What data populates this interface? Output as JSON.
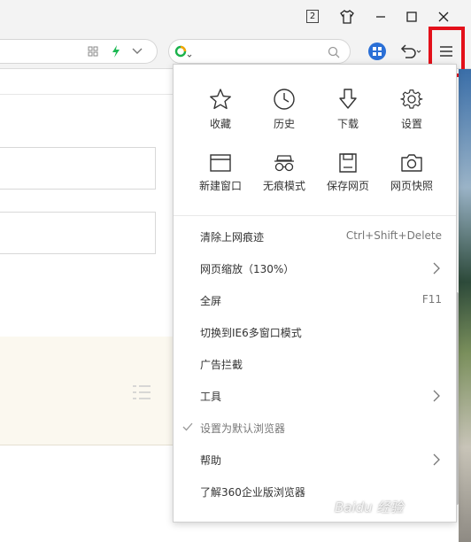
{
  "titlebar": {
    "tab_count": "2",
    "icons": [
      "skin-icon",
      "minimize-icon",
      "maximize-icon",
      "close-icon"
    ]
  },
  "toolbar": {
    "icons": [
      "grid-icon",
      "lightning-icon",
      "chevron-down-icon",
      "360-search-logo-icon",
      "search-icon",
      "apps-icon",
      "undo-icon",
      "menu-icon"
    ]
  },
  "menu": {
    "grid": [
      {
        "label": "收藏",
        "icon": "star-icon"
      },
      {
        "label": "历史",
        "icon": "clock-icon"
      },
      {
        "label": "下载",
        "icon": "download-icon"
      },
      {
        "label": "设置",
        "icon": "gear-icon"
      },
      {
        "label": "新建窗口",
        "icon": "new-window-icon"
      },
      {
        "label": "无痕模式",
        "icon": "incognito-icon"
      },
      {
        "label": "保存网页",
        "icon": "save-icon"
      },
      {
        "label": "网页快照",
        "icon": "camera-icon"
      }
    ],
    "items": [
      {
        "label": "清除上网痕迹",
        "shortcut": "Ctrl+Shift+Delete"
      },
      {
        "label": "网页缩放（130%）",
        "submenu": true
      },
      {
        "label": "全屏",
        "shortcut": "F11"
      },
      {
        "label": "切换到IE6多窗口模式"
      },
      {
        "label": "广告拦截"
      },
      {
        "label": "工具",
        "submenu": true
      },
      {
        "label": "设置为默认浏览器",
        "checked": true,
        "disabled": true
      },
      {
        "label": "帮助",
        "submenu": true
      },
      {
        "label": "了解360企业版浏览器"
      }
    ]
  },
  "watermark": "Baidu 经验",
  "colors": {
    "highlight": "#e3101a",
    "accent": "#2a6fd6"
  }
}
